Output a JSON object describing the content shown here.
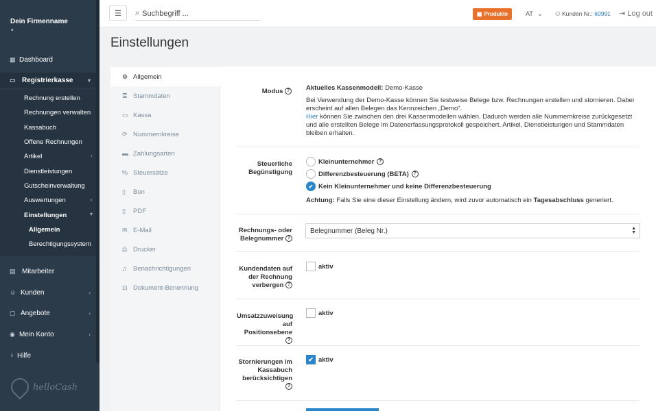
{
  "sidebar": {
    "company": "Dein Firmenname",
    "items": [
      {
        "label": "Dashboard",
        "icon": "dashboard-icon"
      },
      {
        "label": "Registrierkasse",
        "icon": "cash-register-icon"
      },
      {
        "label": "Mitarbeiter",
        "icon": "employees-icon"
      },
      {
        "label": "Kunden",
        "icon": "customers-icon"
      },
      {
        "label": "Angebote",
        "icon": "offers-icon"
      },
      {
        "label": "Mein Konto",
        "icon": "account-icon"
      },
      {
        "label": "Hilfe",
        "icon": "help-bulb-icon"
      }
    ],
    "sub": [
      "Rechnung erstellen",
      "Rechnungen verwalten",
      "Kassabuch",
      "Offene Rechnungen",
      "Artikel",
      "Dienstleistungen",
      "Gutscheinverwaltung",
      "Auswertungen",
      "Einstellungen"
    ],
    "sub2": [
      "Allgemein",
      "Berechtigungssystem"
    ],
    "logo_text": "helloCash"
  },
  "topbar": {
    "search_placeholder": "Suchbegriff ...",
    "produkte": "Produkte",
    "lang": "AT",
    "customer_label": "Kunden Nr.:",
    "customer_no": "60991",
    "logout": "Log out"
  },
  "page": {
    "title": "Einstellungen"
  },
  "tabs": [
    "Allgemein",
    "Stammdaten",
    "Kassa",
    "Nummernkreise",
    "Zahlungsarten",
    "Steuersätze",
    "Bon",
    "PDF",
    "E-Mail",
    "Drucker",
    "Benachrichtigungen",
    "Dokument-Benennung"
  ],
  "settings": {
    "modus": {
      "label": "Modus",
      "current_label": "Aktuelles Kassenmodell:",
      "current_value": "Demo-Kasse",
      "desc": "Bei Verwendung der Demo-Kasse können Sie testweise Belege bzw. Rechnungen erstellen und stornieren. Dabei erscheint auf allen Belegen das Kennzeichen „Demo“.",
      "link": "Hier",
      "desc2": "können Sie zwischen den drei Kassenmodellen wählen. Dadurch werden alle Nummernkreise zurückgesetzt und alle erstellten Belege im Datenerfassungsprotokoll gespeichert. Artikel, Dienstleistungen und Stammdaten bleiben erhalten."
    },
    "steuer": {
      "label1": "Steuerliche",
      "label2": "Begünstigung",
      "options": [
        "Kleinunternehmer",
        "Differenzbesteuerung (BETA)",
        "Kein Kleinunternehmer und keine Differenzbesteuerung"
      ],
      "selected": 2,
      "warn_label": "Achtung:",
      "warn_text": "Falls Sie eine dieser Einstellung ändern, wird zuvor automatisch ein",
      "warn_bold": "Tagesabschluss",
      "warn_end": "generiert."
    },
    "nummer": {
      "label1": "Rechnungs- oder",
      "label2": "Belegnummer",
      "value": "Belegnummer (Beleg Nr.)"
    },
    "kundendaten": {
      "label1": "Kundendaten auf",
      "label2": "der Rechnung",
      "label3": "verbergen",
      "check_label": "aktiv",
      "checked": false
    },
    "umsatz": {
      "label1": "Umsatzzuweisung",
      "label2": "auf",
      "label3": "Positionsebene",
      "check_label": "aktiv",
      "checked": false
    },
    "storno": {
      "label1": "Stornierungen im",
      "label2": "Kassabuch",
      "label3": "berücksichtigen",
      "check_label": "aktiv",
      "checked": true
    }
  }
}
